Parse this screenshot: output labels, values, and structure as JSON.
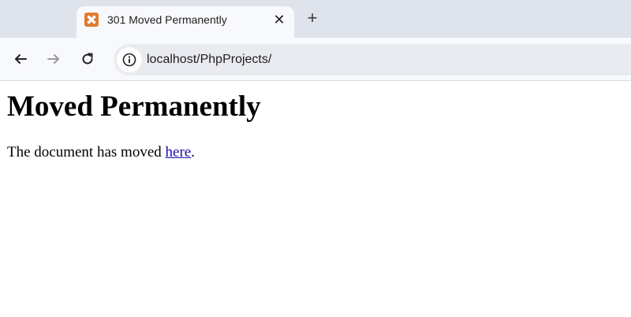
{
  "browser": {
    "tab": {
      "title": "301 Moved Permanently",
      "favicon": "xampp-logo-icon",
      "favicon_color": "#e07a2e",
      "close_glyph": "✕"
    },
    "new_tab_glyph": "+",
    "toolbar": {
      "back_icon": "arrow-left-icon",
      "forward_icon": "arrow-right-icon",
      "reload_icon": "reload-icon",
      "site_info_icon": "info-icon"
    },
    "address_bar": {
      "url": "localhost/PhpProjects/"
    }
  },
  "page": {
    "heading": "Moved Permanently",
    "paragraph_before": "The document has moved ",
    "link_text": "here",
    "paragraph_after": ".",
    "link_color": "#1a0dab"
  }
}
